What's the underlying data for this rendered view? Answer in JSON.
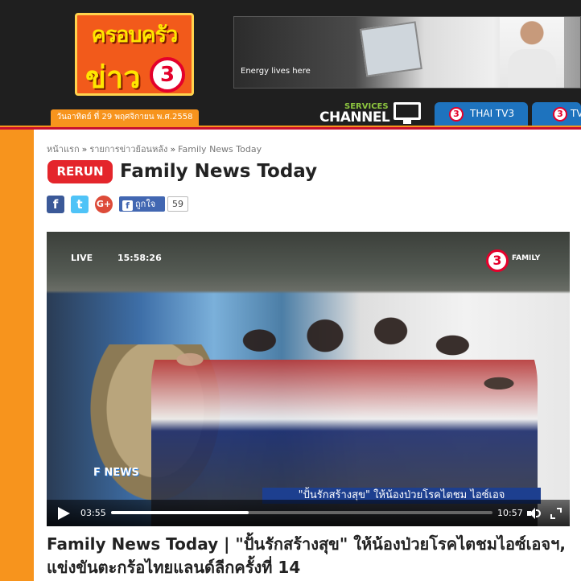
{
  "header": {
    "logo_line1": "ครอบครัว",
    "logo_line2": "ข่าว",
    "logo_channel": "3",
    "date": "วันอาทิตย์ ที่ 29 พฤศจิกายน พ.ศ.2558",
    "ad_text": "Energy lives here",
    "services_label": "SERVICES",
    "channel_label": "CHANNEL",
    "tabs": [
      {
        "channel": "3",
        "label": "THAI TV3"
      },
      {
        "channel": "3",
        "label": "TV"
      }
    ]
  },
  "breadcrumb": {
    "home": "หน้าแรก",
    "archive": "รายการข่าวย้อนหลัง",
    "current": "Family News Today",
    "separator": "»"
  },
  "program": {
    "badge": "RERUN",
    "title": "Family News Today"
  },
  "social": {
    "facebook_glyph": "f",
    "twitter_glyph": "t",
    "gplus_glyph": "G+",
    "like_label": "ถูกใจ",
    "like_count": "59"
  },
  "video": {
    "live_label": "LIVE",
    "live_clock": "15:58:26",
    "watermark_channel": "3",
    "watermark_label": "FAMILY",
    "news_logo": "F NEWS",
    "caption": "\"ปั้นรักสร้างสุข\" ให้น้องป่วยโรคไตชม ไอซ์เอจ",
    "time_current": "03:55",
    "time_total": "10:57",
    "progress_fraction": 0.36
  },
  "article": {
    "title": "Family News Today | \"ปั้นรักสร้างสุข\" ให้น้องป่วยโรคไตชมไอซ์เอจฯ, แข่งขันตะกร้อไทยแลนด์ลีกครั้งที่ 14"
  },
  "colors": {
    "header_bg": "#1f1f1f",
    "accent_orange": "#f7941d",
    "rerun_red": "#e4252b",
    "tab_blue": "#1e73be"
  }
}
